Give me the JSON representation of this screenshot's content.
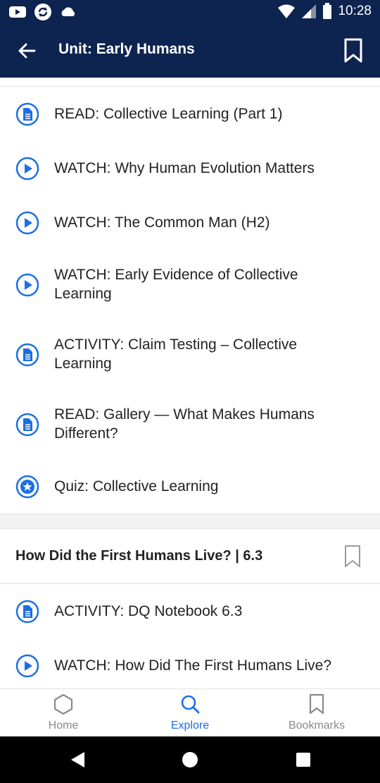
{
  "status_bar": {
    "time": "10:28",
    "left_icons": [
      "youtube-icon",
      "sync-icon",
      "cloud-icon"
    ],
    "right_icons": [
      "wifi-icon",
      "signal-icon",
      "battery-icon"
    ]
  },
  "app_bar": {
    "title": "Unit: Early Humans",
    "back_icon": "arrow-left-icon",
    "bookmark_icon": "bookmark-outline-icon"
  },
  "items": [
    {
      "type": "document",
      "label": "READ: Collective Learning (Part 1)"
    },
    {
      "type": "video",
      "label": "WATCH: Why Human Evolution Matters"
    },
    {
      "type": "video",
      "label": "WATCH: The Common Man (H2)"
    },
    {
      "type": "video",
      "label": "WATCH: Early Evidence of Collective Learning"
    },
    {
      "type": "document",
      "label": "ACTIVITY: Claim Testing – Collective Learning"
    },
    {
      "type": "document",
      "label": "READ: Gallery — What Makes Humans Different?"
    },
    {
      "type": "quiz",
      "label": "Quiz: Collective Learning"
    }
  ],
  "section": {
    "title": "How Did the First Humans Live? | 6.3",
    "items": [
      {
        "type": "document",
        "label": "ACTIVITY: DQ Notebook 6.3"
      },
      {
        "type": "video",
        "label": "WATCH: How Did The First Humans Live?"
      }
    ]
  },
  "bottom_nav": {
    "tabs": [
      {
        "label": "Home",
        "icon": "hexagon-icon",
        "active": false
      },
      {
        "label": "Explore",
        "icon": "search-icon",
        "active": true
      },
      {
        "label": "Bookmarks",
        "icon": "bookmark-icon",
        "active": false
      }
    ]
  },
  "colors": {
    "header_bg": "#0d2350",
    "accent": "#1c6fe3",
    "inactive": "#8a8a8a"
  }
}
